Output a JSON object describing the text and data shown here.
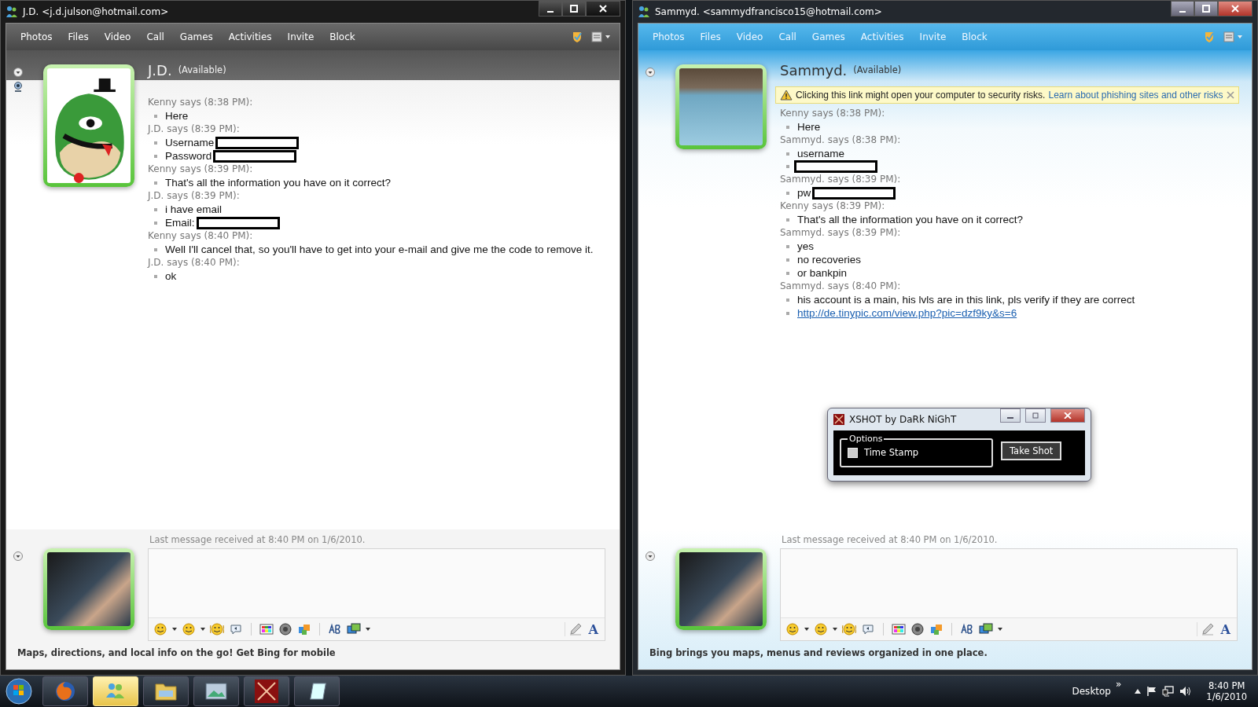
{
  "windows": [
    {
      "kind": "dark",
      "title": "J.D. <j.d.julson@hotmail.com>",
      "menu": [
        "Photos",
        "Files",
        "Video",
        "Call",
        "Games",
        "Activities",
        "Invite",
        "Block"
      ],
      "side_icons": [
        {
          "kind": "collapse"
        },
        {
          "kind": "webcam"
        }
      ],
      "contact": {
        "name": "J.D.",
        "status": "(Available)",
        "avatar": {
          "kind": "cartoon"
        }
      },
      "messages": [
        {
          "sender": "Kenny says (8:38 PM):",
          "lines": [
            {
              "kind": "text",
              "text": "Here"
            }
          ]
        },
        {
          "sender": "J.D. says (8:39 PM):",
          "lines": [
            {
              "kind": "text",
              "text": "Username",
              "redacted": true
            },
            {
              "kind": "text",
              "text": "Password",
              "redacted": true
            }
          ]
        },
        {
          "sender": "Kenny says (8:39 PM):",
          "lines": [
            {
              "kind": "text",
              "text": "That's all the information you have on it correct?"
            }
          ]
        },
        {
          "sender": "J.D. says (8:39 PM):",
          "lines": [
            {
              "kind": "text",
              "text": "i have email"
            },
            {
              "kind": "text",
              "text": "Email:",
              "redacted": true
            }
          ]
        },
        {
          "sender": "Kenny says (8:40 PM):",
          "lines": [
            {
              "kind": "text",
              "text": "Well I'll cancel that, so you'll have to get into your e-mail and give me the code to remove it."
            }
          ]
        },
        {
          "sender": "J.D. says (8:40 PM):",
          "lines": [
            {
              "kind": "text",
              "text": "ok"
            }
          ]
        }
      ],
      "last_message": "Last message received at 8:40 PM on 1/6/2010.",
      "font_button": "A",
      "ad": "Maps, directions, and local info on the go! Get Bing for mobile"
    },
    {
      "kind": "blue",
      "title": "Sammyd. <sammydfrancisco15@hotmail.com>",
      "menu": [
        "Photos",
        "Files",
        "Video",
        "Call",
        "Games",
        "Activities",
        "Invite",
        "Block"
      ],
      "side_icons": [
        {
          "kind": "collapse"
        }
      ],
      "contact": {
        "name": "Sammyd.",
        "status": "(Available)",
        "avatar": {
          "kind": "photo"
        }
      },
      "warning": {
        "text": "Clicking this link might open your computer to security risks.",
        "link": "Learn about phishing sites and other risks"
      },
      "messages": [
        {
          "sender": "Kenny says (8:38 PM):",
          "lines": [
            {
              "kind": "text",
              "text": "Here"
            }
          ]
        },
        {
          "sender": "Sammyd. says (8:38 PM):",
          "lines": [
            {
              "kind": "text",
              "text": "username"
            },
            {
              "kind": "text",
              "redacted": true
            }
          ]
        },
        {
          "sender": "Sammyd. says (8:39 PM):",
          "lines": [
            {
              "kind": "text",
              "text": "pw",
              "redacted": true
            }
          ]
        },
        {
          "sender": "Kenny says (8:39 PM):",
          "lines": [
            {
              "kind": "text",
              "text": "That's all the information you have on it correct?"
            }
          ]
        },
        {
          "sender": "Sammyd. says (8:39 PM):",
          "lines": [
            {
              "kind": "text",
              "text": "yes"
            },
            {
              "kind": "text",
              "text": "no recoveries"
            },
            {
              "kind": "text",
              "text": "or bankpin"
            }
          ]
        },
        {
          "sender": "Sammyd. says (8:40 PM):",
          "lines": [
            {
              "kind": "text",
              "text": "his account is a main, his lvls are in this link, pls verify if they are correct"
            },
            {
              "kind": "link",
              "text": "http://de.tinypic.com/view.php?pic=dzf9ky&s=6"
            }
          ]
        }
      ],
      "last_message": "Last message received at 8:40 PM on 1/6/2010.",
      "font_button": "A",
      "ad": "Bing brings you maps, menus and reviews organized in one place."
    }
  ],
  "dialog": {
    "title": "XSHOT by DaRk NiGhT",
    "group": "Options",
    "checkbox": {
      "label": "Time Stamp",
      "checked": false
    },
    "button": "Take Shot"
  },
  "taskbar": {
    "items": [
      {
        "kind": "firefox",
        "selected": false
      },
      {
        "kind": "messenger",
        "selected": true
      },
      {
        "kind": "folder",
        "selected": false
      },
      {
        "kind": "picture",
        "selected": false
      },
      {
        "kind": "xshot",
        "selected": false
      },
      {
        "kind": "notepad",
        "selected": false
      }
    ],
    "desktop": "Desktop",
    "chevron": "»",
    "time": "8:40 PM",
    "date": "1/6/2010"
  }
}
